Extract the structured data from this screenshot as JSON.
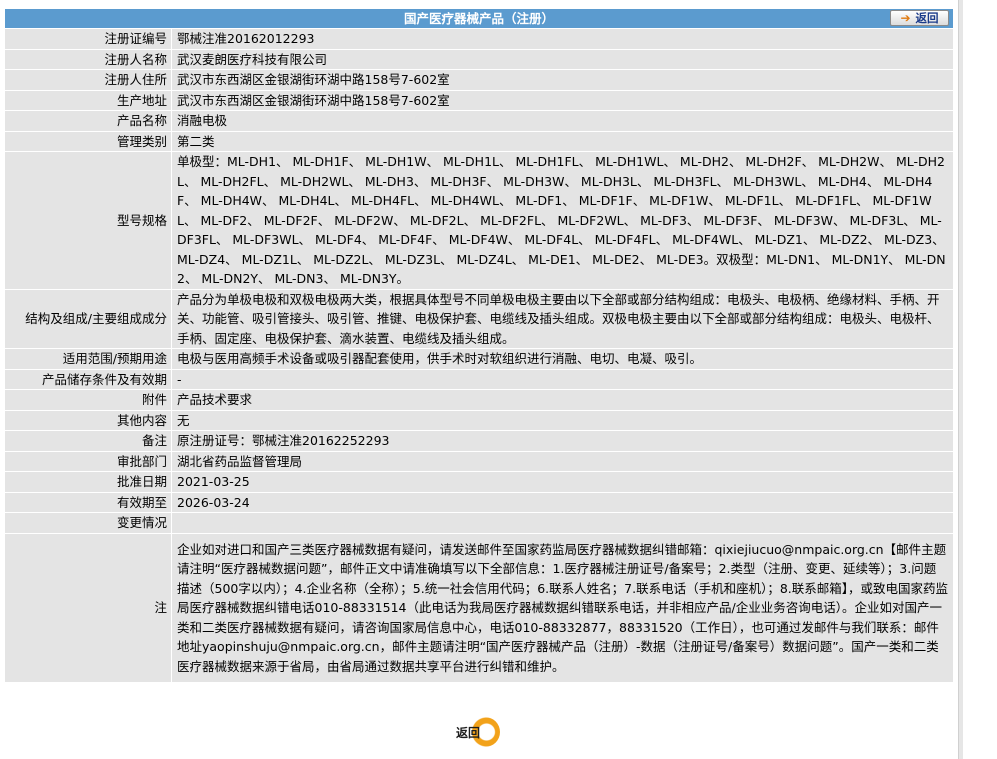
{
  "header": {
    "title": "国产医疗器械产品（注册）",
    "back_label": "返回",
    "back_icon": "arrow-right-icon"
  },
  "rows": [
    {
      "key": "注册证编号",
      "value": "鄂械注准20162012293"
    },
    {
      "key": "注册人名称",
      "value": "武汉麦朗医疗科技有限公司"
    },
    {
      "key": "注册人住所",
      "value": "武汉市东西湖区金银湖街环湖中路158号7-602室"
    },
    {
      "key": "生产地址",
      "value": "武汉市东西湖区金银湖街环湖中路158号7-602室"
    },
    {
      "key": "产品名称",
      "value": "消融电极"
    },
    {
      "key": "管理类别",
      "value": "第二类"
    },
    {
      "key": "型号规格",
      "value": "单极型：ML-DH1、 ML-DH1F、 ML-DH1W、 ML-DH1L、 ML-DH1FL、 ML-DH1WL、 ML-DH2、 ML-DH2F、 ML-DH2W、 ML-DH2L、 ML-DH2FL、 ML-DH2WL、 ML-DH3、 ML-DH3F、 ML-DH3W、 ML-DH3L、 ML-DH3FL、 ML-DH3WL、 ML-DH4、 ML-DH4F、 ML-DH4W、 ML-DH4L、 ML-DH4FL、 ML-DH4WL、 ML-DF1、 ML-DF1F、 ML-DF1W、 ML-DF1L、 ML-DF1FL、 ML-DF1WL、 ML-DF2、 ML-DF2F、 ML-DF2W、 ML-DF2L、 ML-DF2FL、 ML-DF2WL、 ML-DF3、 ML-DF3F、 ML-DF3W、 ML-DF3L、 ML-DF3FL、 ML-DF3WL、 ML-DF4、 ML-DF4F、 ML-DF4W、 ML-DF4L、 ML-DF4FL、 ML-DF4WL、 ML-DZ1、 ML-DZ2、 ML-DZ3、 ML-DZ4、 ML-DZ1L、 ML-DZ2L、 ML-DZ3L、 ML-DZ4L、 ML-DE1、 ML-DE2、 ML-DE3。双极型：ML-DN1、 ML-DN1Y、 ML-DN2、 ML-DN2Y、 ML-DN3、 ML-DN3Y。"
    },
    {
      "key": "结构及组成/主要组成成分",
      "value": "产品分为单极电极和双极电极两大类，根据具体型号不同单极电极主要由以下全部或部分结构组成：电极头、电极柄、绝缘材料、手柄、开关、功能管、吸引管接头、吸引管、推键、电极保护套、电缆线及插头组成。双极电极主要由以下全部或部分结构组成：电极头、电极杆、手柄、固定座、电极保护套、滴水装置、电缆线及插头组成。"
    },
    {
      "key": "适用范围/预期用途",
      "value": "电极与医用高频手术设备或吸引器配套使用，供手术时对软组织进行消融、电切、电凝、吸引。"
    },
    {
      "key": "产品储存条件及有效期",
      "value": "-"
    },
    {
      "key": "附件",
      "value": "产品技术要求"
    },
    {
      "key": "其他内容",
      "value": "无"
    },
    {
      "key": "备注",
      "value": "原注册证号：鄂械注准20162252293"
    },
    {
      "key": "审批部门",
      "value": "湖北省药品监督管理局"
    },
    {
      "key": "批准日期",
      "value": "2021-03-25"
    },
    {
      "key": "有效期至",
      "value": "2026-03-24"
    },
    {
      "key": "变更情况",
      "value": ""
    },
    {
      "key": "注",
      "value": "企业如对进口和国产三类医疗器械数据有疑问，请发送邮件至国家药监局医疗器械数据纠错邮箱：qixiejiucuo@nmpaic.org.cn【邮件主题请注明“医疗器械数据问题”，邮件正文中请准确填写以下全部信息：1.医疗器械注册证号/备案号；2.类型（注册、变更、延续等）；3.问题描述（500字以内）；4.企业名称（全称）；5.统一社会信用代码；6.联系人姓名；7.联系电话（手机和座机）；8.联系邮箱】，或致电国家药监局医疗器械数据纠错电话010-88331514（此电话为我局医疗器械数据纠错联系电话，并非相应产品/企业业务咨询电话）。企业如对国产一类和二类医疗器械数据有疑问，请咨询国家局信息中心，电话010-88332877，88331520（工作日），也可通过发邮件与我们联系：邮件地址yaopinshuju@nmpaic.org.cn，邮件主题请注明“国产医疗器械产品（注册）-数据（注册证号/备案号）数据问题”。国产一类和二类医疗器械数据来源于省局，由省局通过数据共享平台进行纠错和维护。"
    }
  ],
  "footer": {
    "back_label": "返回"
  }
}
